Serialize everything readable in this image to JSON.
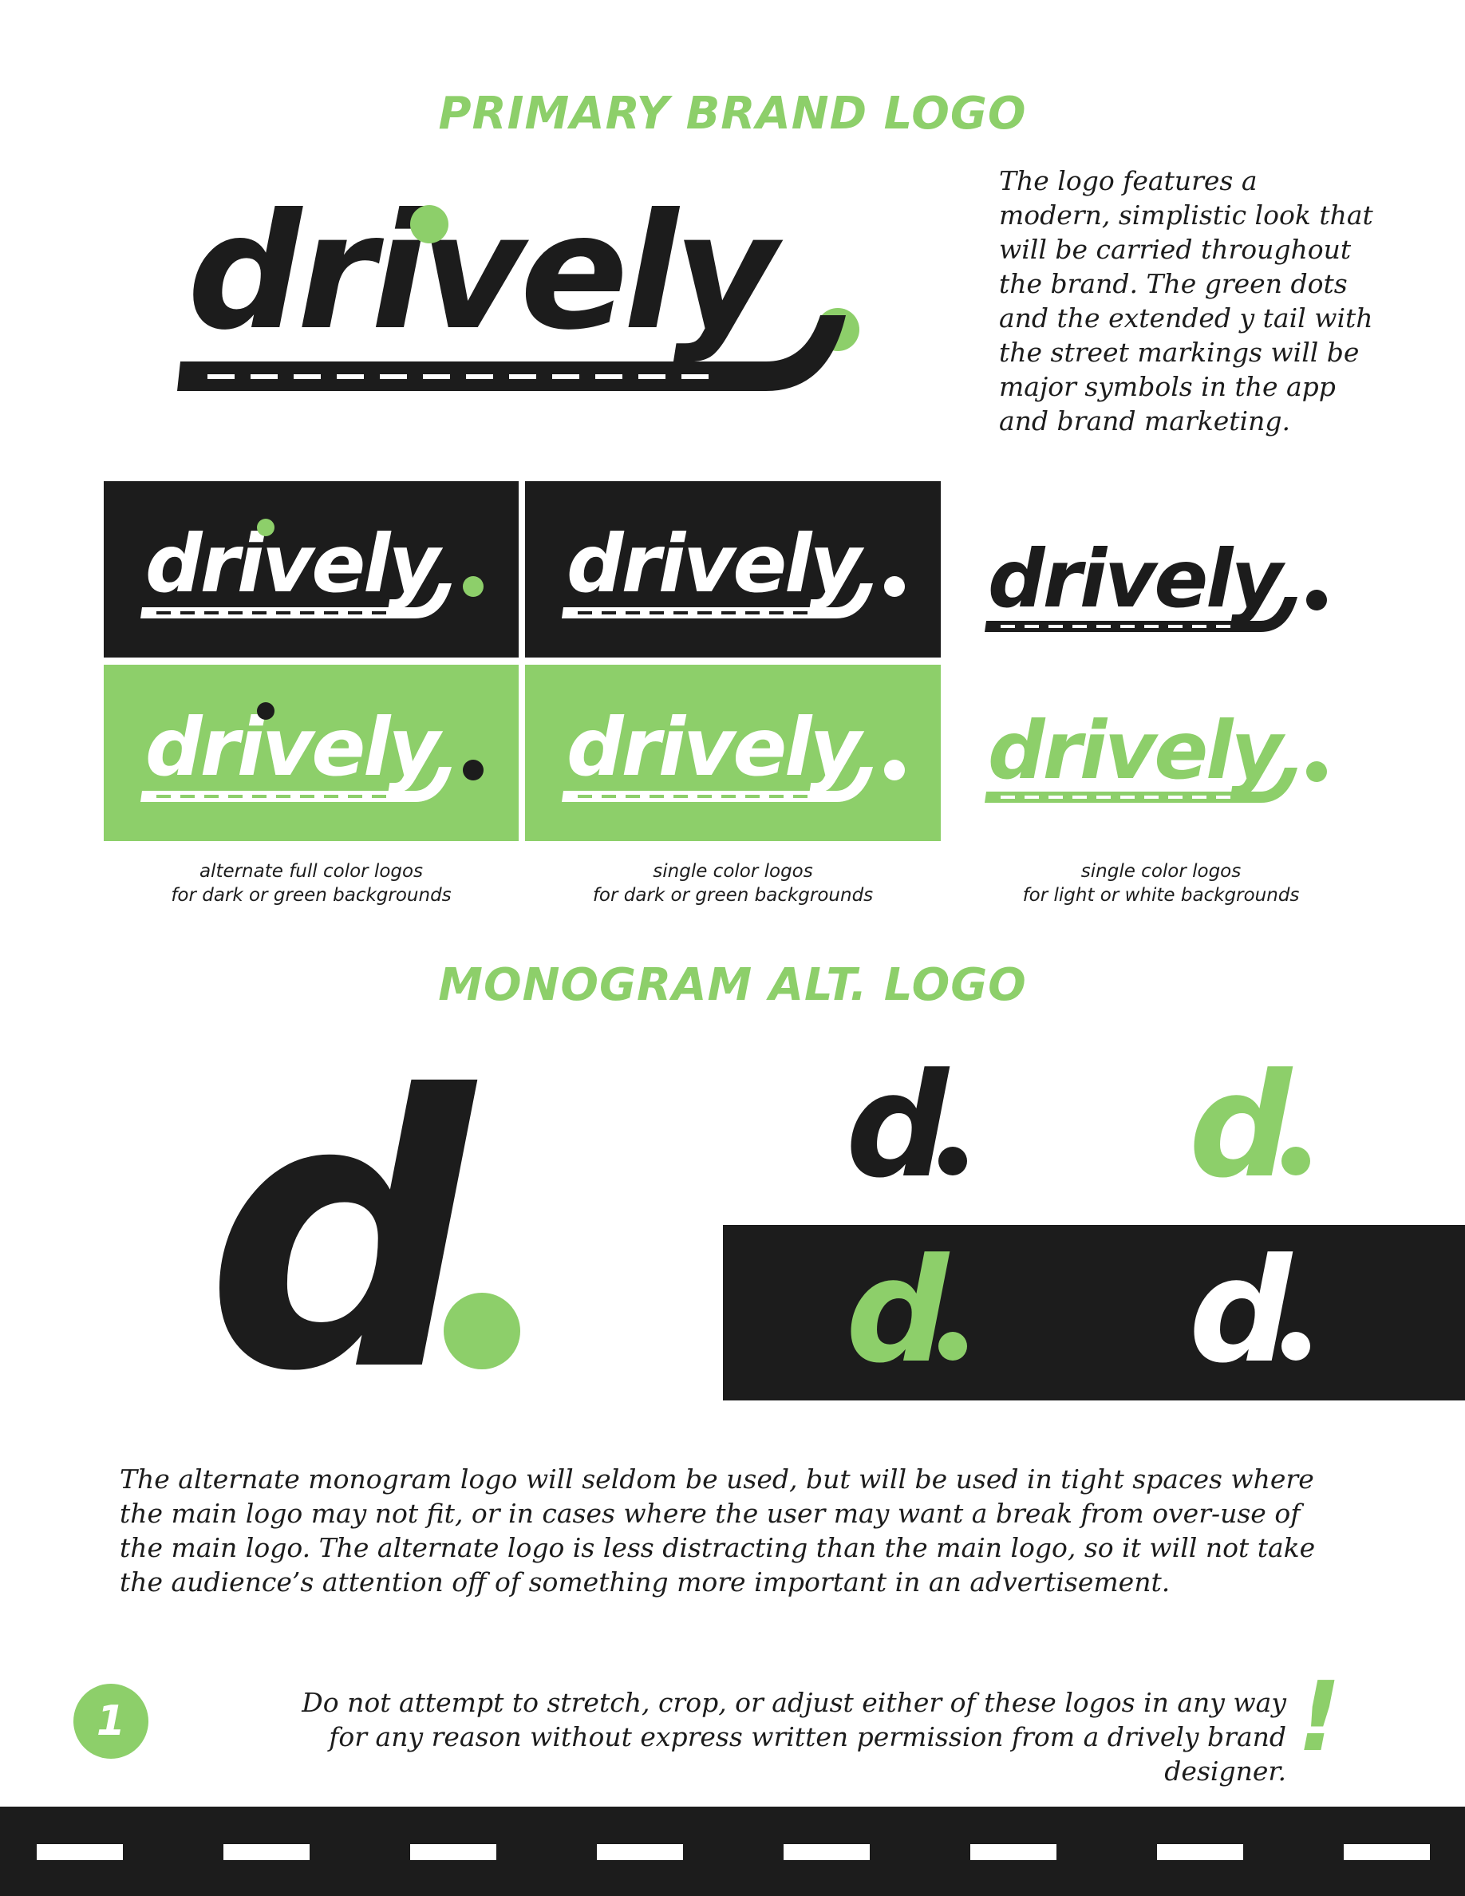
{
  "primary": {
    "heading": "PRIMARY BRAND LOGO",
    "wordmark": "drively",
    "description": "The logo features a modern, simplistic look that will be carried throughout the brand. The green dots and the extended y tail with the street markings will be major symbols in the app and brand marketing."
  },
  "variants": {
    "captions": [
      "alternate full color logos\nfor dark or green backgrounds",
      "single color logos\nfor dark or green backgrounds",
      "single color logos\nfor light or white backgrounds"
    ]
  },
  "monogram": {
    "heading": "MONOGRAM ALT. LOGO",
    "letter": "d",
    "description": "The alternate monogram logo will seldom be used, but will be used in tight spaces where the main logo may not fit, or in cases where the user may want a break from over-use of the main logo. The alternate logo is less distracting than the main logo, so it will not take the audience’s attention off of something more important in an advertisement."
  },
  "footer": {
    "page_number": "1",
    "warning": "Do not attempt to stretch, crop, or adjust either of these logos in any way for any reason without express written permission from a drively brand designer.",
    "exclamation": "!"
  },
  "colors": {
    "brand_green": "#8dcf6a",
    "brand_dark": "#1c1c1c",
    "white": "#ffffff"
  }
}
